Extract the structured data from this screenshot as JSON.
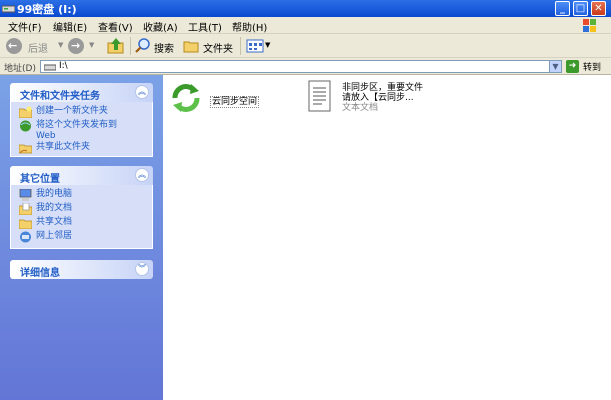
{
  "window": {
    "title": "99密盘 (I:)",
    "buttons": [
      "_",
      "□",
      "✕"
    ]
  },
  "menu": {
    "items": [
      "文件(F)",
      "编辑(E)",
      "查看(V)",
      "收藏(A)",
      "工具(T)",
      "帮助(H)"
    ]
  },
  "toolbar": {
    "back_label": "后退",
    "search_label": "搜索",
    "folders_label": "文件夹"
  },
  "address": {
    "label": "地址(D)",
    "value": "I:\\",
    "go_label": "转到"
  },
  "left_pane": {
    "tasks": {
      "title": "文件和文件夹任务",
      "items": [
        {
          "label": "创建一个新文件夹",
          "icon": "new-folder-icon"
        },
        {
          "label": "将这个文件夹发布到\nWeb",
          "icon": "publish-web-icon"
        },
        {
          "label": "共享此文件夹",
          "icon": "share-folder-icon"
        }
      ]
    },
    "other_places": {
      "title": "其它位置",
      "items": [
        {
          "label": "我的电脑",
          "icon": "my-computer-icon"
        },
        {
          "label": "我的文档",
          "icon": "my-documents-icon"
        },
        {
          "label": "共享文档",
          "icon": "shared-documents-icon"
        },
        {
          "label": "网上邻居",
          "icon": "network-places-icon"
        }
      ]
    },
    "details": {
      "title": "详细信息"
    }
  },
  "content": {
    "items": [
      {
        "name": "云同步空间",
        "icon": "sync-folder-icon"
      },
      {
        "name": "非同步区，重要文件\n请放入【云同步...",
        "type": "文本文档",
        "icon": "text-document-icon"
      }
    ]
  },
  "colors": {
    "titlebar": "#0a49d0",
    "left_pane": "#6f8ee0",
    "link": "#215dc6"
  }
}
